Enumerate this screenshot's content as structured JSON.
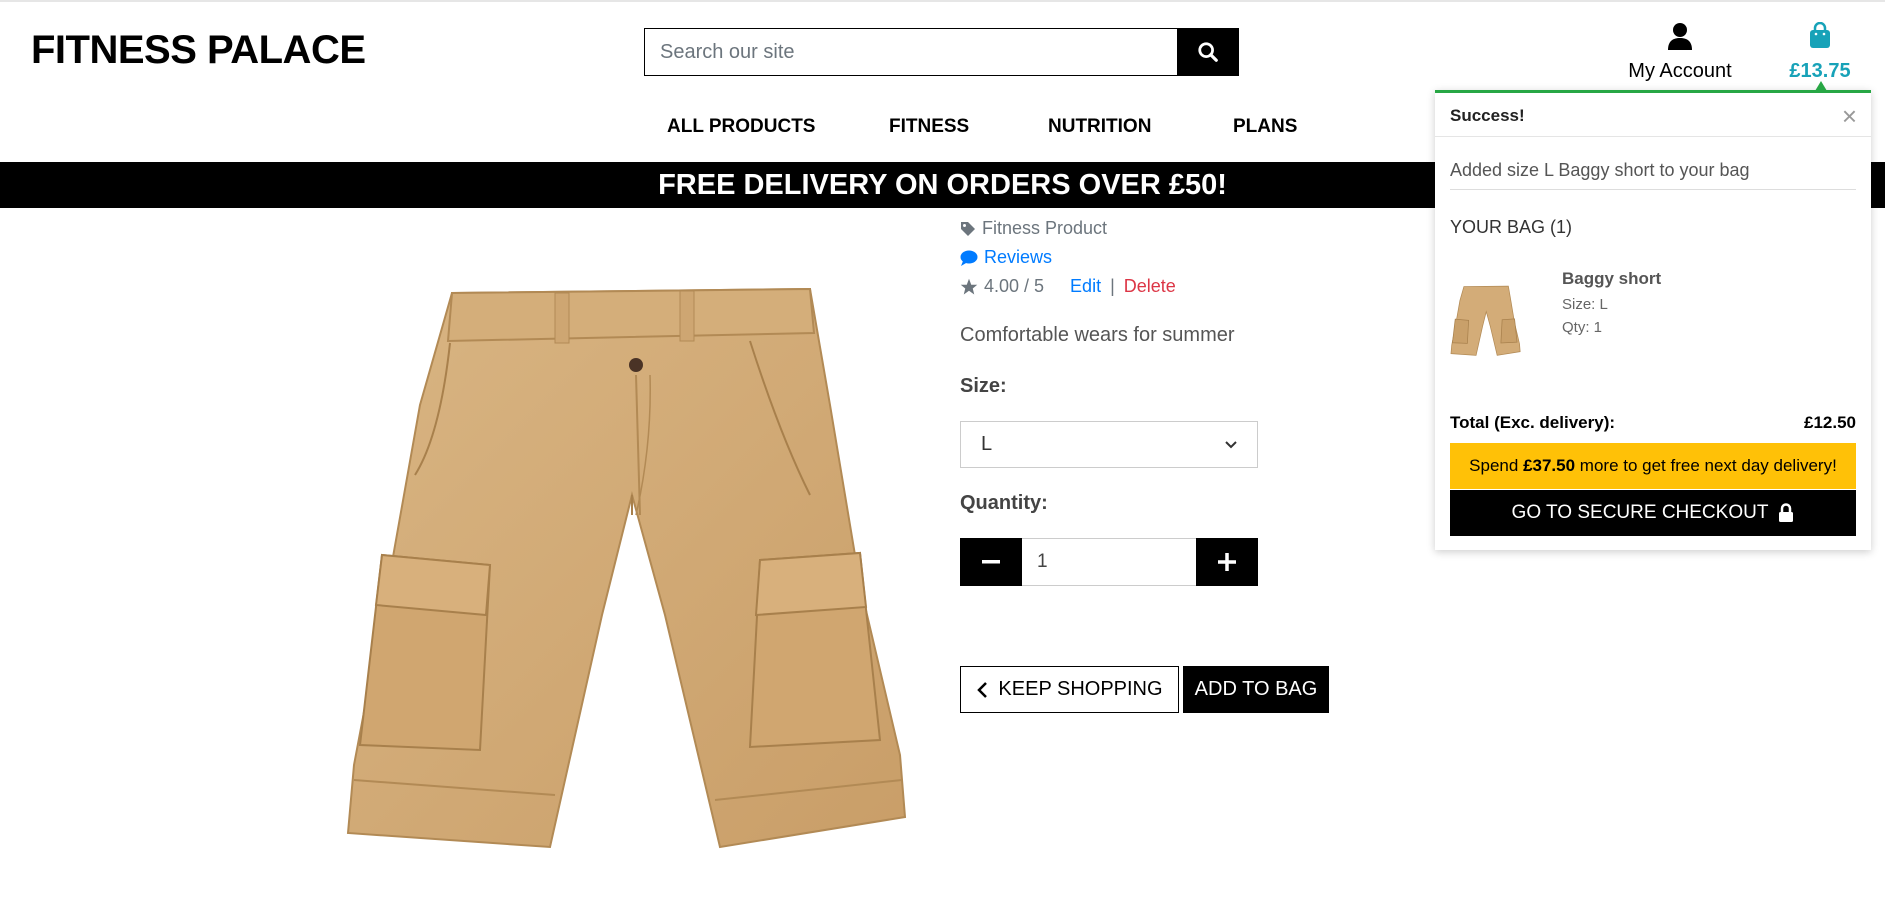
{
  "header": {
    "logo": "FITNESS PALACE",
    "search_placeholder": "Search our site",
    "account_label": "My Account",
    "bag_total": "£13.75"
  },
  "nav": {
    "items": [
      "ALL PRODUCTS",
      "FITNESS",
      "NUTRITION",
      "PLANS"
    ]
  },
  "banner": "FREE DELIVERY ON ORDERS OVER £50!",
  "product": {
    "category": "Fitness Product",
    "reviews_link": "Reviews",
    "rating": "4.00 / 5",
    "edit": "Edit",
    "separator": "|",
    "delete": "Delete",
    "description": "Comfortable wears for summer",
    "size_label": "Size:",
    "size_value": "L",
    "quantity_label": "Quantity:",
    "quantity_value": "1",
    "keep_shopping": "KEEP SHOPPING",
    "add_to_bag": "ADD TO BAG"
  },
  "toast": {
    "title": "Success!",
    "close": "×",
    "message": "Added size L Baggy short to your bag",
    "bag_heading": "YOUR BAG (1)",
    "item_name": "Baggy short",
    "item_size": "Size: L",
    "item_qty": "Qty: 1",
    "total_label": "Total (Exc. delivery):",
    "total_value": "£12.50",
    "spend_prefix": "Spend",
    "spend_amount": "£37.50",
    "spend_suffix": "more to get free next day delivery!",
    "checkout_label": "GO TO SECURE CHECKOUT"
  },
  "colors": {
    "accent": "#17a2b8",
    "success": "#28a745",
    "warning": "#ffc107",
    "link": "#007bff",
    "danger": "#dc3545"
  }
}
